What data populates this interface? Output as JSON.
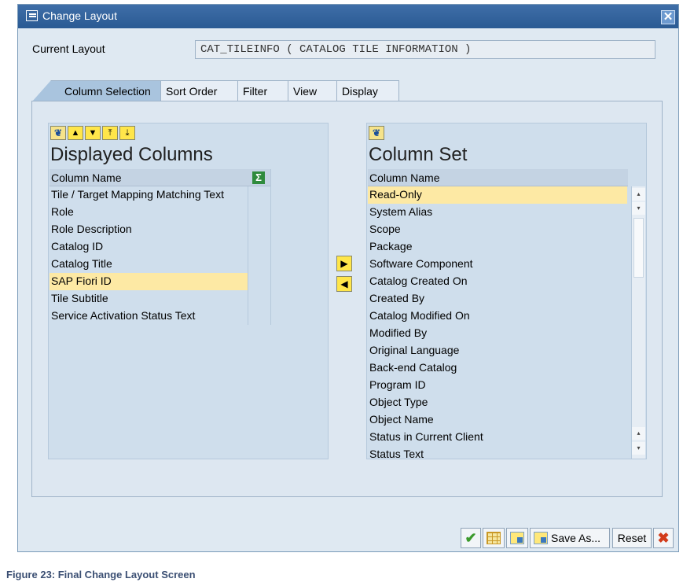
{
  "window": {
    "title": "Change Layout",
    "close_symbol": "✕"
  },
  "current_layout": {
    "label": "Current Layout",
    "value": "CAT_TILEINFO ( CATALOG TILE INFORMATION )"
  },
  "tabs": [
    {
      "label": "Column Selection",
      "active": true
    },
    {
      "label": "Sort Order"
    },
    {
      "label": "Filter"
    },
    {
      "label": "View"
    },
    {
      "label": "Display"
    }
  ],
  "displayed_columns": {
    "title": "Displayed Columns",
    "header": "Column Name",
    "rows": [
      "Tile / Target Mapping Matching Text",
      "Role",
      "Role Description",
      "Catalog ID",
      "Catalog Title",
      "SAP Fiori ID",
      "Tile Subtitle",
      "Service Activation Status Text"
    ],
    "selected_index": 5
  },
  "column_set": {
    "title": "Column Set",
    "header": "Column Name",
    "rows": [
      "Read-Only",
      "System Alias",
      "Scope",
      "Package",
      "Software Component",
      "Catalog Created On",
      "Created By",
      "Catalog Modified On",
      "Modified By",
      "Original Language",
      "Back-end Catalog",
      "Program ID",
      "Object Type",
      "Object Name",
      "Status in Current Client",
      "Status Text"
    ],
    "selected_index": 0
  },
  "icons": {
    "find": "binoculars-icon",
    "sigma": "Σ",
    "up": "▲",
    "down": "▼",
    "top": "⯭",
    "bottom": "⯯",
    "move_right": "▶",
    "move_left": "◀",
    "check": "✔",
    "cancel": "✖"
  },
  "footer": {
    "save_as_label": "Save As...",
    "reset_label": "Reset"
  },
  "caption": "Figure 23: Final Change Layout Screen",
  "colors": {
    "title_bar": "#2f5e98",
    "selection": "#fde9a4",
    "tab_active": "#a9c4de",
    "button_yellow": "#ffe64a"
  }
}
